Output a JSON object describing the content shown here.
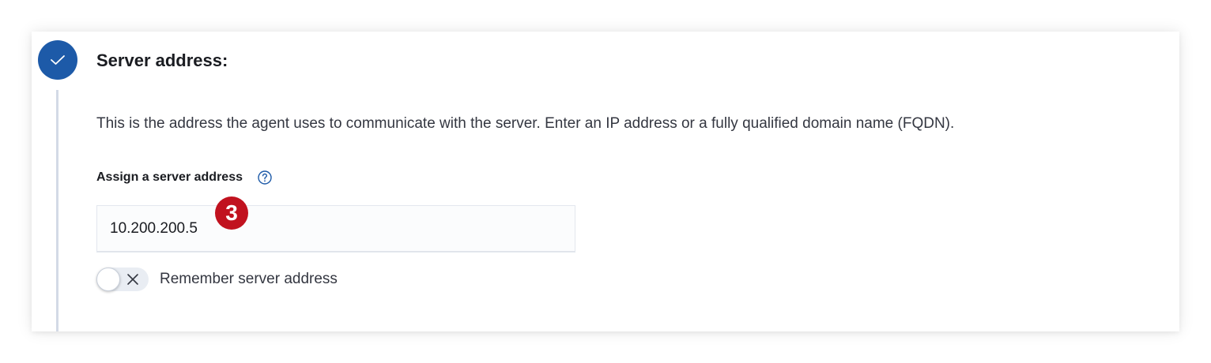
{
  "step": {
    "title": "Server address:",
    "status_icon": "check-icon",
    "accent_color": "#1d5aa8"
  },
  "description": "This is the address the agent uses to communicate with the server. Enter an IP address or a fully qualified domain name (FQDN).",
  "field": {
    "label": "Assign a server address",
    "help_icon": "question-circle-icon",
    "value": "10.200.200.5"
  },
  "annotation": {
    "badge_number": "3",
    "badge_color": "#c1121f"
  },
  "toggle": {
    "label": "Remember server address",
    "state": "off"
  }
}
